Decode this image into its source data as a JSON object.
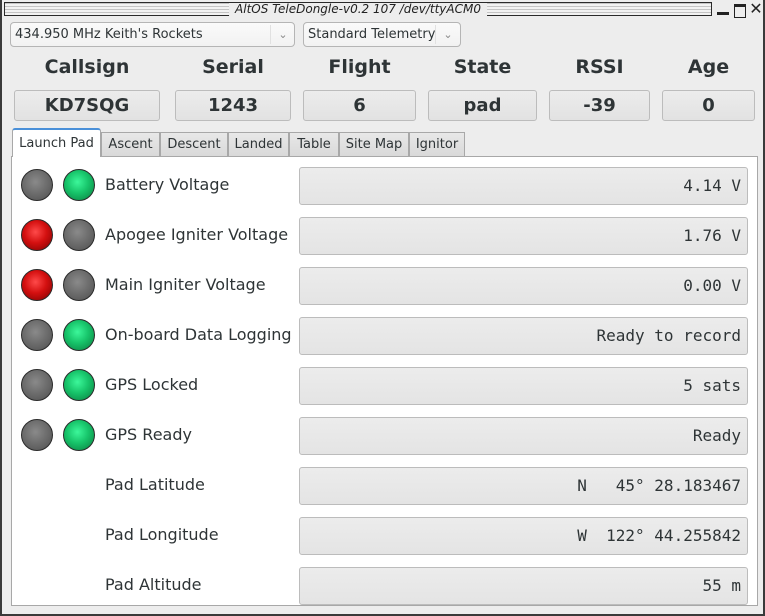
{
  "window": {
    "title": "AltOS TeleDongle-v0.2 107 /dev/ttyACM0",
    "controls": {
      "minimize": "minimize",
      "maximize": "maximize",
      "close": "✕"
    }
  },
  "toolbar": {
    "frequency": "434.950 MHz Keith's Rockets",
    "telemetry": "Standard Telemetry",
    "chevron": "⌄"
  },
  "header": {
    "labels": [
      "Callsign",
      "Serial",
      "Flight",
      "State",
      "RSSI",
      "Age"
    ],
    "values": [
      "KD7SQG",
      "1243",
      "6",
      "pad",
      "-39",
      "0"
    ]
  },
  "tabs": [
    {
      "label": "Launch Pad",
      "active": true
    },
    {
      "label": "Ascent",
      "active": false
    },
    {
      "label": "Descent",
      "active": false
    },
    {
      "label": "Landed",
      "active": false
    },
    {
      "label": "Table",
      "active": false
    },
    {
      "label": "Site Map",
      "active": false
    },
    {
      "label": "Ignitor",
      "active": false
    }
  ],
  "launch_pad": {
    "rows": [
      {
        "label": "Battery Voltage",
        "value": "4.14 V",
        "led1": "gray",
        "led2": "green"
      },
      {
        "label": "Apogee Igniter Voltage",
        "value": "1.76 V",
        "led1": "red",
        "led2": "gray"
      },
      {
        "label": "Main Igniter Voltage",
        "value": "0.00 V",
        "led1": "red",
        "led2": "gray"
      },
      {
        "label": "On-board Data Logging",
        "value": "Ready to record",
        "led1": "gray",
        "led2": "green"
      },
      {
        "label": "GPS Locked",
        "value": "5 sats",
        "led1": "gray",
        "led2": "green"
      },
      {
        "label": "GPS Ready",
        "value": "Ready",
        "led1": "gray",
        "led2": "green"
      },
      {
        "label": "Pad Latitude",
        "value": "N   45° 28.183467"
      },
      {
        "label": "Pad Longitude",
        "value": "W  122° 44.255842"
      },
      {
        "label": "Pad Altitude",
        "value": "55 m"
      }
    ]
  },
  "colors": {
    "led_green": "#17c46a",
    "led_red": "#d41010",
    "led_gray": "#6e6e6e",
    "tab_accent": "#4a90d9"
  }
}
